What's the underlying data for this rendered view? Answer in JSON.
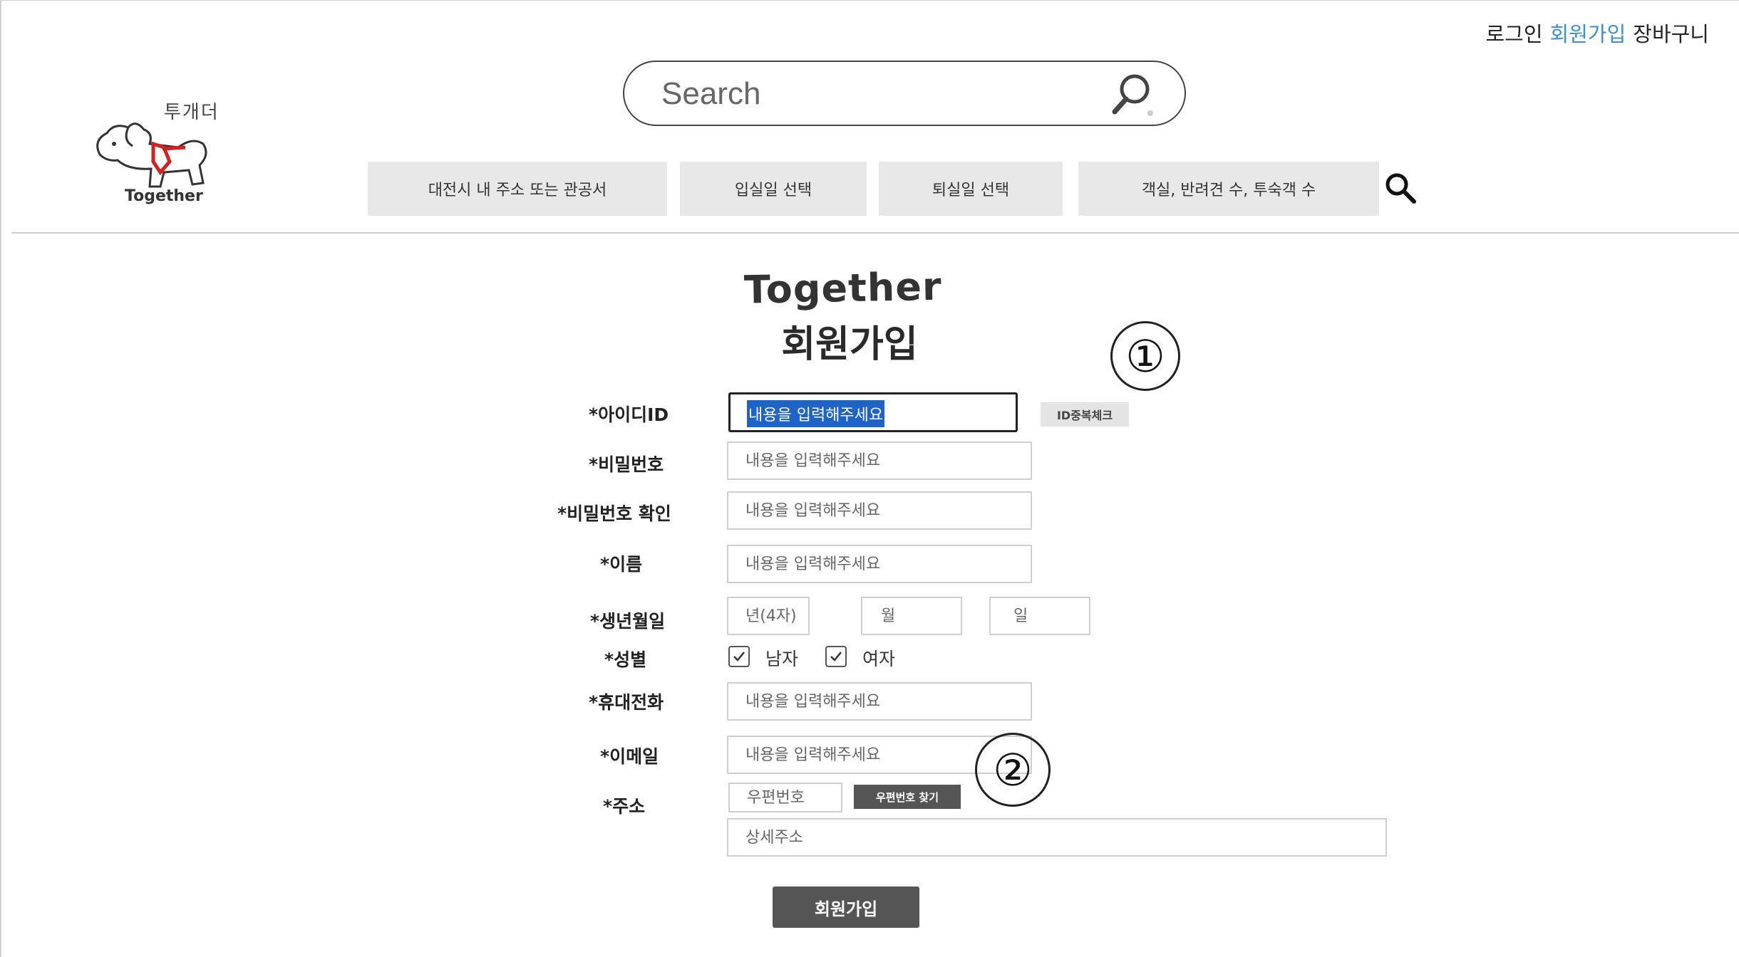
{
  "header": {
    "links": {
      "login": "로그인",
      "signup": "회원가입",
      "cart": "장바구니"
    },
    "accent_color": "#3a8fd6",
    "logo": {
      "hangul": "투개더",
      "text": "Together"
    },
    "search": {
      "placeholder": "Search"
    },
    "filters": {
      "location": "대전시 내 주소 또는 관공서",
      "checkin": "입실일 선택",
      "checkout": "퇴실일 선택",
      "guests": "객실, 반려견 수, 투숙객 수"
    }
  },
  "form": {
    "brand": "Together",
    "title": "회원가입",
    "markers": {
      "one": "①",
      "two": "②"
    },
    "fields": {
      "id": {
        "label": "*아이디ID",
        "value": "내용을 입력해주세요",
        "button": "ID중복체크"
      },
      "password": {
        "label": "*비밀번호",
        "placeholder": "내용을 입력해주세요"
      },
      "password_confirm": {
        "label": "*비밀번호 확인",
        "placeholder": "내용을 입력해주세요"
      },
      "name": {
        "label": "*이름",
        "placeholder": "내용을 입력해주세요"
      },
      "birth": {
        "label": "*생년월일",
        "year": "년(4자)",
        "month": "월",
        "day": "일"
      },
      "gender": {
        "label": "*성별",
        "male": "남자",
        "female": "여자"
      },
      "phone": {
        "label": "*휴대전화",
        "placeholder": "내용을 입력해주세요"
      },
      "email": {
        "label": "*이메일",
        "placeholder": "내용을 입력해주세요"
      },
      "address": {
        "label": "*주소",
        "postcode": "우편번호",
        "find_button": "우편번호 찾기",
        "detail": "상세주소"
      }
    },
    "submit": "회원가입"
  }
}
